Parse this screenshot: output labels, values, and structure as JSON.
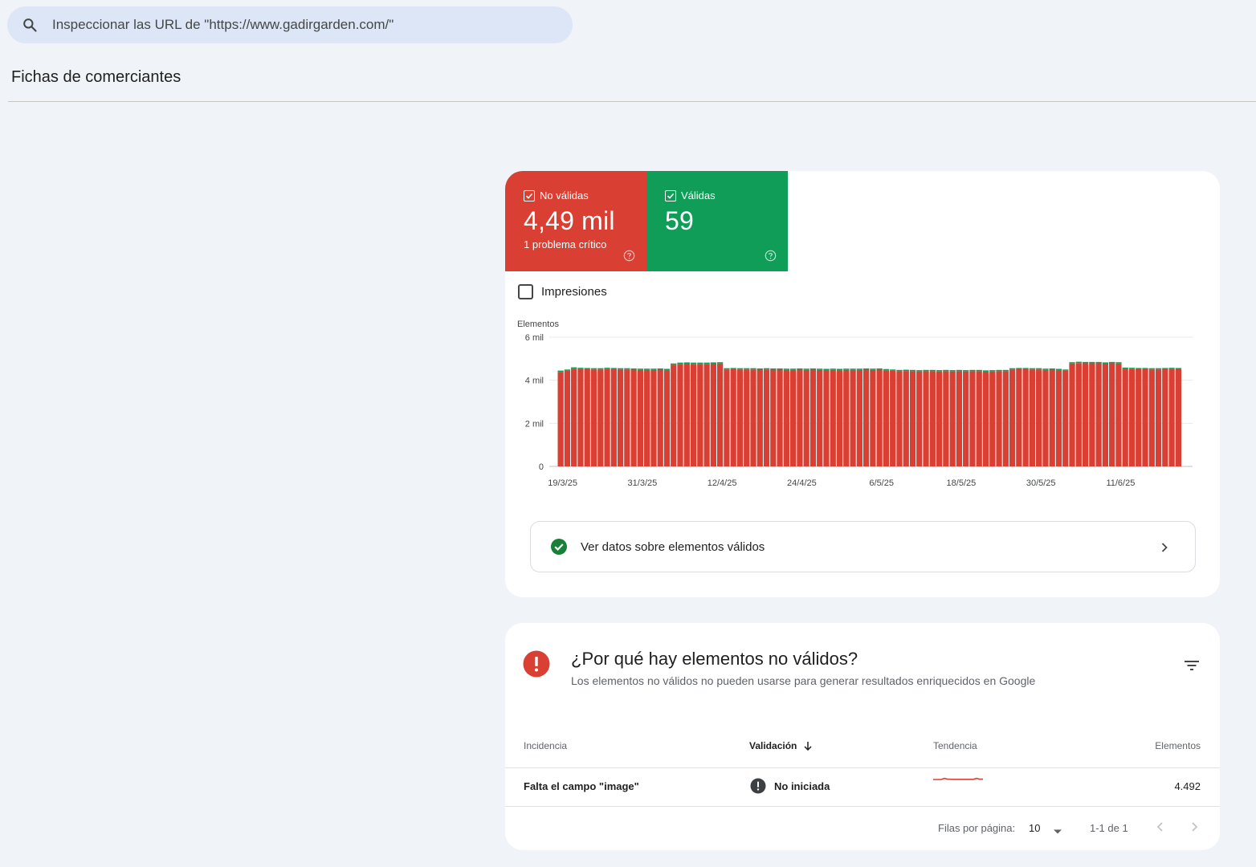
{
  "search": {
    "placeholder": "Inspeccionar las URL de \"https://www.gadirgarden.com/\""
  },
  "page": {
    "title": "Fichas de comerciantes"
  },
  "summary": {
    "invalid": {
      "label": "No válidas",
      "value": "4,49 mil",
      "sub": "1 problema crítico",
      "color": "#d93f33"
    },
    "valid": {
      "label": "Válidas",
      "value": "59",
      "color": "#0f9d58"
    }
  },
  "impressions_label": "Impresiones",
  "chart_data": {
    "type": "bar",
    "ylabel": "Elementos",
    "ylim": [
      0,
      6000
    ],
    "yticks": [
      "6 mil",
      "4 mil",
      "2 mil",
      "0"
    ],
    "ytick_values": [
      6000,
      4000,
      2000,
      0
    ],
    "xtick_labels": [
      "19/3/25",
      "31/3/25",
      "12/4/25",
      "24/4/25",
      "6/5/25",
      "18/5/25",
      "30/5/25",
      "11/6/25"
    ],
    "xtick_indices": [
      0,
      12,
      24,
      36,
      48,
      60,
      72,
      84
    ],
    "series": [
      {
        "name": "No válidas",
        "color": "#d93f33",
        "values": [
          4390,
          4440,
          4540,
          4520,
          4510,
          4500,
          4500,
          4520,
          4510,
          4500,
          4500,
          4490,
          4480,
          4480,
          4480,
          4490,
          4470,
          4720,
          4760,
          4770,
          4760,
          4760,
          4760,
          4770,
          4780,
          4500,
          4510,
          4500,
          4500,
          4500,
          4490,
          4500,
          4490,
          4490,
          4480,
          4480,
          4490,
          4480,
          4490,
          4480,
          4470,
          4480,
          4470,
          4480,
          4480,
          4480,
          4490,
          4480,
          4490,
          4460,
          4440,
          4420,
          4430,
          4420,
          4410,
          4420,
          4420,
          4410,
          4420,
          4410,
          4420,
          4410,
          4420,
          4420,
          4400,
          4410,
          4420,
          4420,
          4500,
          4510,
          4510,
          4500,
          4500,
          4480,
          4490,
          4470,
          4440,
          4780,
          4800,
          4790,
          4790,
          4790,
          4770,
          4790,
          4780,
          4530,
          4520,
          4510,
          4510,
          4500,
          4500,
          4510,
          4520,
          4510
        ]
      },
      {
        "name": "Válidas",
        "color": "#0f9d58",
        "values": [
          59,
          59,
          59,
          59,
          59,
          59,
          59,
          59,
          59,
          59,
          59,
          59,
          59,
          59,
          59,
          59,
          59,
          59,
          59,
          59,
          59,
          59,
          59,
          59,
          59,
          59,
          59,
          59,
          59,
          59,
          59,
          59,
          59,
          59,
          59,
          59,
          59,
          59,
          59,
          59,
          59,
          59,
          59,
          59,
          59,
          59,
          59,
          59,
          59,
          59,
          59,
          59,
          59,
          59,
          59,
          59,
          59,
          59,
          59,
          59,
          59,
          59,
          59,
          59,
          59,
          59,
          59,
          59,
          59,
          59,
          59,
          59,
          59,
          59,
          59,
          59,
          59,
          59,
          59,
          59,
          59,
          59,
          59,
          59,
          59,
          59,
          59,
          59,
          59,
          59,
          59,
          59,
          59,
          59
        ]
      }
    ]
  },
  "valid_link": {
    "label": "Ver datos sobre elementos válidos"
  },
  "issues": {
    "title": "¿Por qué hay elementos no válidos?",
    "description": "Los elementos no válidos no pueden usarse para generar resultados enriquecidos en Google",
    "columns": {
      "incidence": "Incidencia",
      "validation": "Validación",
      "trend": "Tendencia",
      "elements": "Elementos"
    },
    "rows": [
      {
        "incidence": "Falta el campo \"image\"",
        "validation": "No iniciada",
        "elements": "4.492"
      }
    ]
  },
  "pager": {
    "rows_label": "Filas por página:",
    "rows_value": "10",
    "range": "1-1 de 1"
  }
}
